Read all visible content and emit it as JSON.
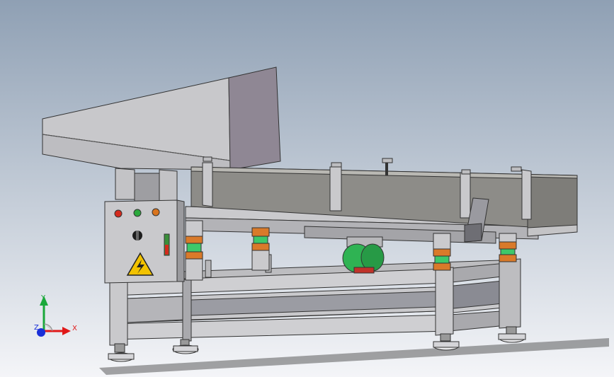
{
  "viewport": {
    "background_top": "#8fa0b4",
    "background_bottom": "#f4f5f8"
  },
  "colors": {
    "steel_light": "#c9c9cc",
    "steel_mid": "#a9a9ad",
    "steel_dark": "#8a8a8e",
    "trough": "#8d8c88",
    "hopper_side": "#8f8794",
    "spring_green": "#3ec86a",
    "spring_orange": "#d97a2a",
    "motor_green": "#2fb353",
    "warning_yellow": "#f2c200",
    "lamp_red": "#d42a1d",
    "lamp_green": "#2aa83c",
    "lamp_orange": "#d9741d",
    "axis_x": "#e01818",
    "axis_y": "#1aa83a",
    "axis_z": "#1a2fd8"
  },
  "control_panel": {
    "indicator_lamps": [
      "red",
      "green",
      "orange"
    ],
    "icons": [
      "selector-switch-icon",
      "high-voltage-warning-icon",
      "handle-icon"
    ]
  },
  "triad": {
    "x_label": "X",
    "y_label": "Y",
    "z_label": "Z"
  }
}
